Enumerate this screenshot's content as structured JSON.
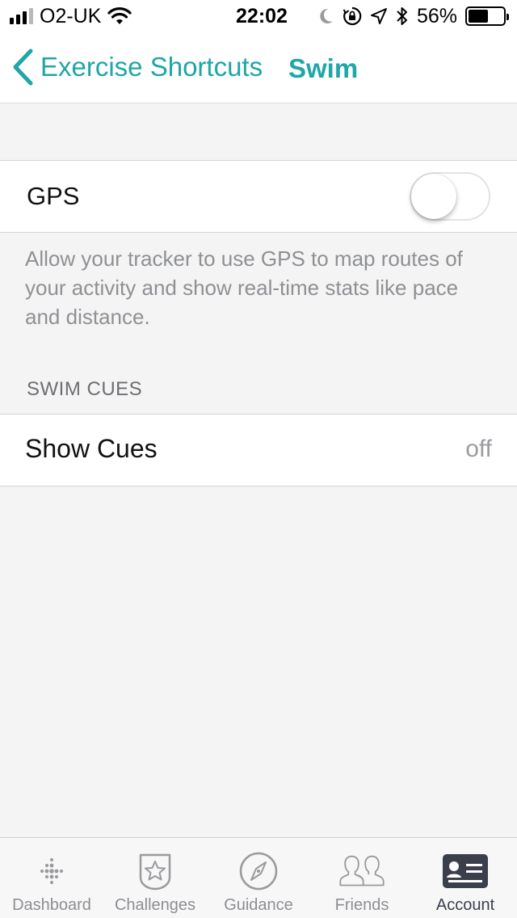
{
  "status_bar": {
    "carrier": "O2-UK",
    "time": "22:02",
    "battery_percent": "56%",
    "battery_level": 0.56,
    "signal_bars": 3,
    "signal_bars_total": 4
  },
  "nav": {
    "back_label": "Exercise Shortcuts",
    "title": "Swim"
  },
  "gps": {
    "label": "GPS",
    "enabled": false,
    "description": "Allow your tracker to use GPS to map routes of your activity and show real-time stats like pace and distance."
  },
  "swim_cues": {
    "section_header": "SWIM CUES",
    "row_label": "Show Cues",
    "row_value": "off"
  },
  "tabs": [
    {
      "label": "Dashboard",
      "icon": "fitbit-dots-icon",
      "active": false
    },
    {
      "label": "Challenges",
      "icon": "badge-star-icon",
      "active": false
    },
    {
      "label": "Guidance",
      "icon": "compass-icon",
      "active": false
    },
    {
      "label": "Friends",
      "icon": "people-icon",
      "active": false
    },
    {
      "label": "Account",
      "icon": "id-card-icon",
      "active": true
    }
  ],
  "colors": {
    "accent": "#1fa6a6",
    "background": "#f4f4f4",
    "secondary_text": "#8e9094",
    "tab_active": "#3a3f4b"
  }
}
